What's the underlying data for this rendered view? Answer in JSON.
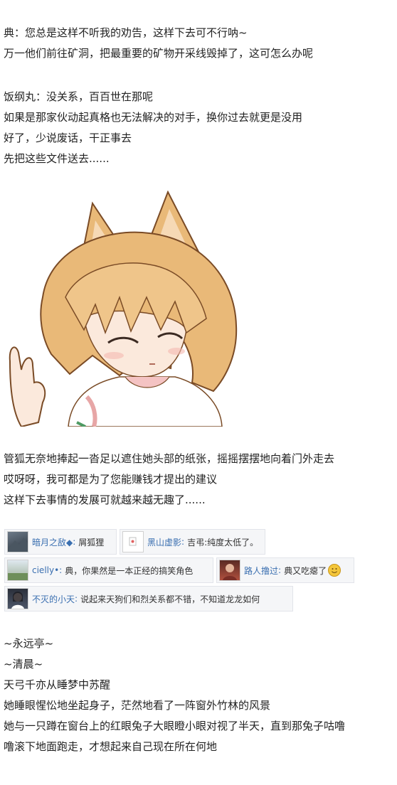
{
  "paragraphs": {
    "p1": [
      "典：您总是这样不听我的劝告，这样下去可不行呐~",
      "万一他们前往矿洞，把最重要的矿物开采线毁掉了，这可怎么办呢"
    ],
    "p2": [
      "饭纲丸：没关系，百百世在那呢",
      "如果是那家伙动起真格也无法解决的对手，换你过去就更是没用",
      "好了，少说废话，干正事去",
      "先把这些文件送去......"
    ],
    "p3": [
      "管狐无奈地捧起一沓足以遮住她头部的纸张，摇摇摆摆地向着门外走去",
      "哎呀呀，我可都是为了您能赚钱才提出的建议",
      "这样下去事情的发展可就越来越无趣了......"
    ],
    "p4": [
      "~永远亭~",
      "~清晨~",
      "天弓千亦从睡梦中苏醒",
      "她睡眼惺忪地坐起身子，茫然地看了一阵窗外竹林的风景",
      "她与一只蹲在窗台上的红眼兔子大眼瞪小眼对视了半天，直到那兔子咕噜",
      "噜滚下地面跑走，才想起来自己现在所在何地"
    ]
  },
  "comments": [
    {
      "user": "暗月之敌◆",
      "text": "屑狐狸",
      "avatar_icon": "dark-landscape-avatar-icon"
    },
    {
      "user": "黑山虚影",
      "text": "吉弔:纯度太低了。",
      "avatar_icon": "document-avatar-icon"
    },
    {
      "user": "cielly•",
      "text": "典，你果然是一本正经的搞笑角色",
      "avatar_icon": "sky-landscape-avatar-icon"
    },
    {
      "user": "路人撸过",
      "text": "典又吃瘪了",
      "avatar_icon": "portrait-avatar-icon",
      "emoji": "smile-emoji-icon"
    },
    {
      "user": "不灭的小天",
      "text": "说起来天狗们和烈关系都不错，不知道龙龙如何",
      "avatar_icon": "character-avatar-icon"
    }
  ],
  "colors": {
    "username": "#3a6fb0",
    "chip_bg": "#f5f6f8",
    "hair": "#e9b978",
    "hair_shadow": "#c98f52"
  }
}
